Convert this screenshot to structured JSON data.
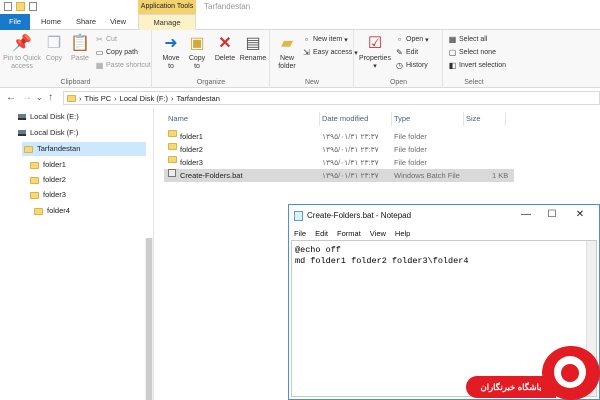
{
  "titlebar": {
    "context_tab": "Application Tools",
    "window_title": "Tarfandestan"
  },
  "ribbon_tabs": {
    "file": "File",
    "home": "Home",
    "share": "Share",
    "view": "View",
    "manage": "Manage"
  },
  "clipboard": {
    "pin": "Pin to Quick",
    "pin2": "access",
    "copy": "Copy",
    "paste": "Paste",
    "cut": "Cut",
    "copy_path": "Copy path",
    "paste_shortcut": "Paste shortcut",
    "label": "Clipboard"
  },
  "organize": {
    "move_to": "Move",
    "move_to2": "to",
    "copy_to": "Copy",
    "copy_to2": "to",
    "delete": "Delete",
    "rename": "Rename",
    "label": "Organize"
  },
  "new_group": {
    "new_folder": "New",
    "new_folder2": "folder",
    "new_item": "New item",
    "easy_access": "Easy access",
    "label": "New"
  },
  "open_group": {
    "properties": "Properties",
    "open": "Open",
    "edit": "Edit",
    "history": "History",
    "label": "Open"
  },
  "select_group": {
    "select_all": "Select all",
    "select_none": "Select none",
    "invert": "Invert selection",
    "label": "Select"
  },
  "address": {
    "segments": [
      "This PC",
      "Local Disk (F:)",
      "Tarfandestan"
    ]
  },
  "navpane": {
    "items": [
      "Local Disk (E:)",
      "Local Disk (F:)",
      "Tarfandestan",
      "folder1",
      "folder2",
      "folder3",
      "folder4"
    ]
  },
  "filelist": {
    "headers": [
      "Name",
      "Date modified",
      "Type",
      "Size"
    ],
    "rows": [
      {
        "name": "folder1",
        "date": "۱۳۹۵/۰۱/۳۱ ۲۳:۳۷",
        "type": "File folder",
        "size": ""
      },
      {
        "name": "folder2",
        "date": "۱۳۹۵/۰۱/۳۱ ۲۳:۳۷",
        "type": "File folder",
        "size": ""
      },
      {
        "name": "folder3",
        "date": "۱۳۹۵/۰۱/۳۱ ۲۳:۳۷",
        "type": "File folder",
        "size": ""
      },
      {
        "name": "Create-Folders.bat",
        "date": "۱۳۹۵/۰۱/۳۱ ۲۳:۳۷",
        "type": "Windows Batch File",
        "size": "1 KB"
      }
    ]
  },
  "notepad": {
    "title": "Create-Folders.bat - Notepad",
    "menu": [
      "File",
      "Edit",
      "Format",
      "View",
      "Help"
    ],
    "lines": [
      "@echo off",
      "md folder1 folder2 folder3\\folder4"
    ]
  },
  "watermark": {
    "text": "باشگاه خبرنگاران"
  },
  "colors": {
    "accent": "#1979ca",
    "context_tab": "#f3d16e",
    "selection": "#cce8ff",
    "watermark": "#e31b23"
  }
}
